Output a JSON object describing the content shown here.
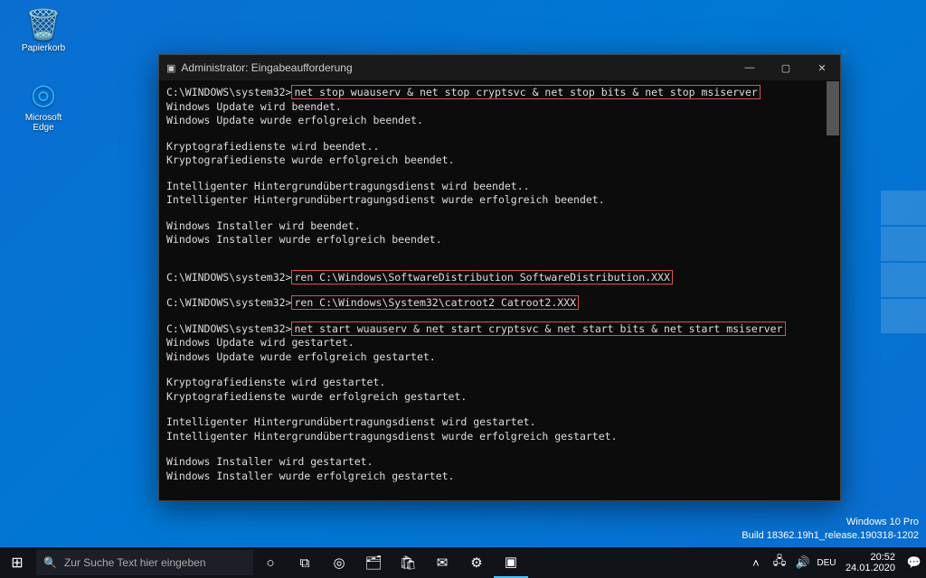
{
  "desktop": {
    "recycle_label": "Papierkorb",
    "edge_label": "Microsoft Edge"
  },
  "cmd": {
    "title": "Administrator: Eingabeaufforderung",
    "prompt": "C:\\WINDOWS\\system32>",
    "cmd1": "net stop wuauserv & net stop cryptsvc & net stop bits & net stop msiserver",
    "l1": "Windows Update wird beendet.",
    "l2": "Windows Update wurde erfolgreich beendet.",
    "l3": "Kryptografiedienste wird beendet..",
    "l4": "Kryptografiedienste wurde erfolgreich beendet.",
    "l5": "Intelligenter Hintergrundübertragungsdienst wird beendet..",
    "l6": "Intelligenter Hintergrundübertragungsdienst wurde erfolgreich beendet.",
    "l7": "Windows Installer wird beendet.",
    "l8": "Windows Installer wurde erfolgreich beendet.",
    "cmd2": "ren C:\\Windows\\SoftwareDistribution SoftwareDistribution.XXX",
    "cmd3": "ren C:\\Windows\\System32\\catroot2 Catroot2.XXX",
    "cmd4": "net start wuauserv & net start cryptsvc & net start bits & net start msiserver",
    "l9": "Windows Update wird gestartet.",
    "l10": "Windows Update wurde erfolgreich gestartet.",
    "l11": "Kryptografiedienste wird gestartet.",
    "l12": "Kryptografiedienste wurde erfolgreich gestartet.",
    "l13": "Intelligenter Hintergrundübertragungsdienst wird gestartet.",
    "l14": "Intelligenter Hintergrundübertragungsdienst wurde erfolgreich gestartet.",
    "l15": "Windows Installer wird gestartet.",
    "l16": "Windows Installer wurde erfolgreich gestartet."
  },
  "taskbar": {
    "search_placeholder": "Zur Suche Text hier eingeben"
  },
  "tray": {
    "time": "20:52",
    "date": "24.01.2020"
  },
  "watermark": {
    "line1": "Windows 10 Pro",
    "line2": "Build 18362.19h1_release.190318-1202"
  }
}
